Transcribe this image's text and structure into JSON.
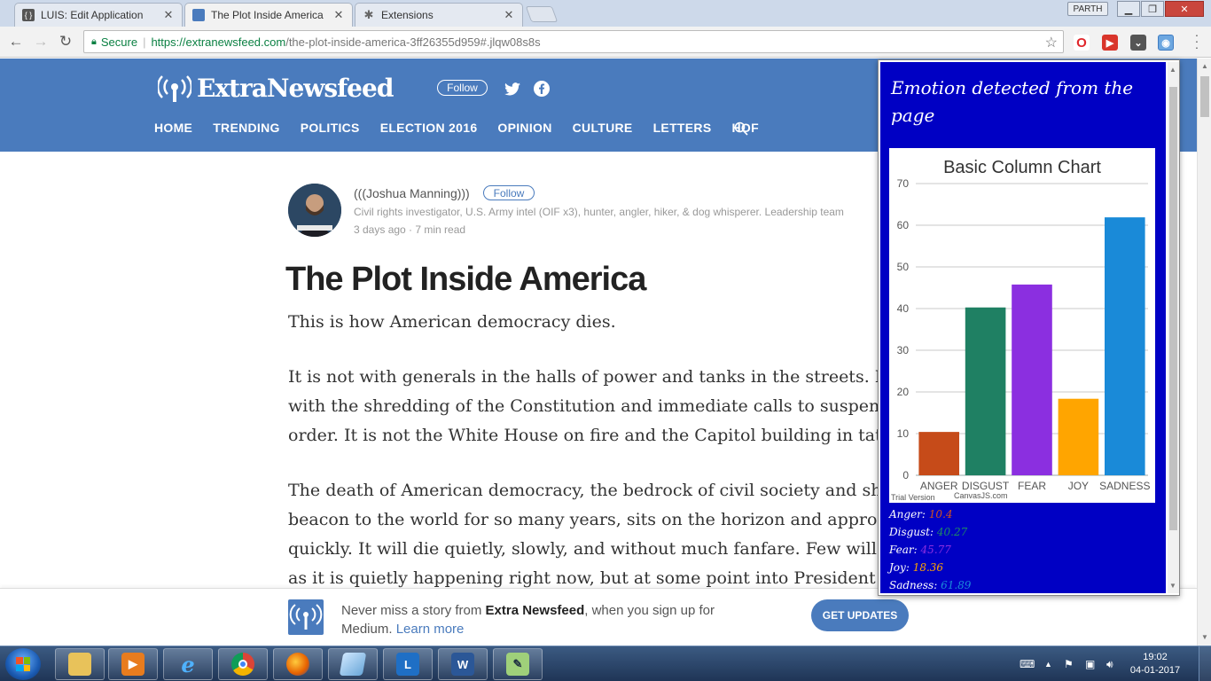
{
  "browser": {
    "tabs": [
      {
        "title": "LUIS: Edit Application",
        "close": "✕"
      },
      {
        "title": "The Plot Inside America",
        "close": "✕"
      },
      {
        "title": "Extensions",
        "close": "✕"
      }
    ],
    "profile": "PARTH",
    "secure_label": "Secure",
    "url_host": "https://extranewsfeed.com",
    "url_path": "/the-plot-inside-america-3ff26355d959#.jlqw08s8s"
  },
  "site": {
    "logo_text": "ExtraNewsfeed",
    "follow_label": "Follow",
    "nav": [
      "HOME",
      "TRENDING",
      "POLITICS",
      "ELECTION 2016",
      "OPINION",
      "CULTURE",
      "LETTERS",
      "HOF"
    ]
  },
  "article": {
    "author_name": "(((Joshua Manning)))",
    "author_follow": "Follow",
    "author_bio": "Civil rights investigator, U.S. Army intel (OIF x3), hunter, angler, hiker, & dog whisperer. Leadership team",
    "meta": "3 days ago · 7 min read",
    "title": "The Plot Inside America",
    "subtitle": "This is how American democracy dies.",
    "lines": [
      "It is not with generals in the halls of power and tanks in the streets. It is n",
      "with the shredding of the Constitution and immediate calls to suspend",
      "order. It is not the White House on fire and the Capitol building in tatters.",
      "The death of American democracy, the bedrock of civil society and shining",
      "beacon to the world for so many years, sits on the horizon and approaches",
      "quickly. It will die quietly, slowly, and without much fanfare. Few will notic",
      "as it is quietly happening right now, but at some point into President Donal"
    ]
  },
  "banner": {
    "text_prefix": "Never miss a story from ",
    "text_brand": "Extra Newsfeed",
    "text_suffix": ", when you sign up for Medium. ",
    "learn_more": "Learn more",
    "button": "GET UPDATES"
  },
  "popup": {
    "title": "Emotion detected from the page",
    "watermark_1": "Trial Version",
    "watermark_2": "CanvasJS.com",
    "emotions": [
      {
        "label": "Anger:",
        "value": "10.4",
        "color": "#d0521e"
      },
      {
        "label": "Disgust:",
        "value": "40.27",
        "color": "#1f8a64"
      },
      {
        "label": "Fear:",
        "value": "45.77",
        "color": "#8d2ee0"
      },
      {
        "label": "Joy:",
        "value": "18.36",
        "color": "#ffa500"
      },
      {
        "label": "Sadness:",
        "value": "61.89",
        "color": "#1a8ad8"
      }
    ]
  },
  "chart_data": {
    "type": "bar",
    "title": "Basic Column Chart",
    "categories": [
      "ANGER",
      "DISGUST",
      "FEAR",
      "JOY",
      "SADNESS"
    ],
    "values": [
      10.4,
      40.27,
      45.77,
      18.36,
      61.89
    ],
    "colors": [
      "#c64b19",
      "#1f8063",
      "#8b2fe0",
      "#ffa500",
      "#1a8ad8"
    ],
    "ylim": [
      0,
      70
    ],
    "yticks": [
      0,
      10,
      20,
      30,
      40,
      50,
      60,
      70
    ],
    "grid": true,
    "xlabel": "",
    "ylabel": ""
  },
  "taskbar": {
    "time": "19:02",
    "date": "04-01-2017"
  }
}
